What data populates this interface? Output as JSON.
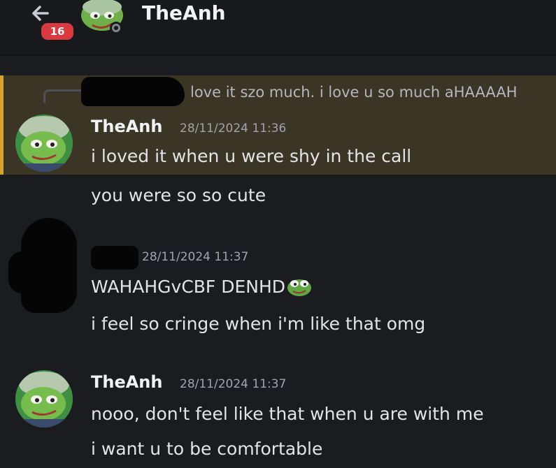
{
  "header": {
    "title": "TheAnh",
    "unread_count": "16",
    "back_icon": "arrow-left-icon",
    "status": "offline"
  },
  "messages": {
    "reply_preview": "love it szo much. i love u so much aHAAAAH",
    "group1": {
      "author": "TheAnh",
      "timestamp": "28/11/2024 11:36",
      "lines": [
        "i loved it when u were shy in the call",
        "you were so so cute"
      ]
    },
    "group2": {
      "timestamp": "28/11/2024 11:37",
      "lines": [
        "WAHAHGvCBF DENHD",
        "i feel so cringe when i'm like that omg"
      ],
      "emoji": "pepe-emoji"
    },
    "group3": {
      "author": "TheAnh",
      "timestamp": "28/11/2024 11:37",
      "lines": [
        "nooo, don't feel like that when u are with me",
        "i want  u to be comfortable"
      ]
    }
  },
  "colors": {
    "background": "#1b1c20",
    "mention_highlight": "#3a3524",
    "mention_bar": "#d6a42b",
    "badge": "#d83a3f"
  }
}
